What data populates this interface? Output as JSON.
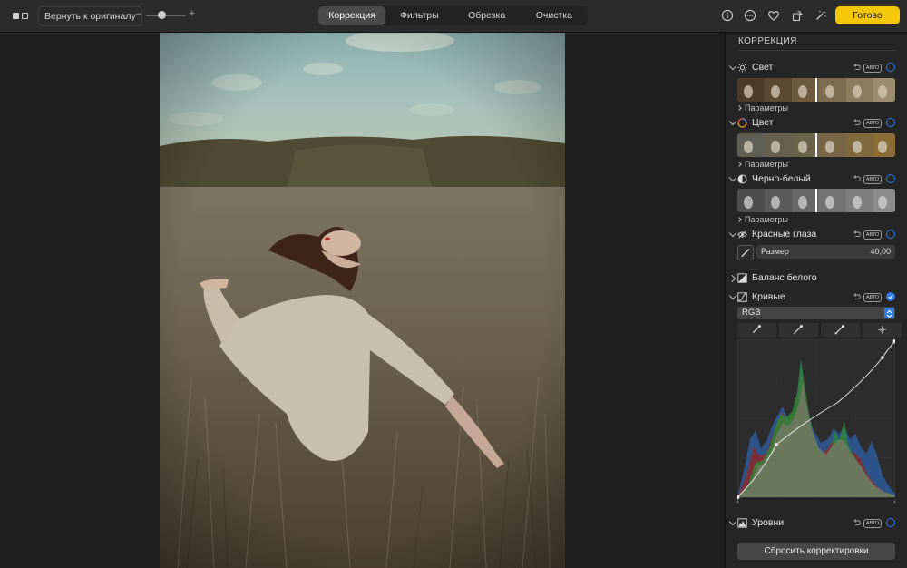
{
  "toolbar": {
    "revert_label": "Вернуть к оригиналу",
    "zoom_minus": "–",
    "zoom_plus": "+",
    "tabs": [
      {
        "label": "Коррекция",
        "active": true
      },
      {
        "label": "Фильтры",
        "active": false
      },
      {
        "label": "Обрезка",
        "active": false
      },
      {
        "label": "Очистка",
        "active": false
      }
    ],
    "done_label": "Готово",
    "accent_color": "#f5c70a",
    "icons": [
      "info-icon",
      "more-icon",
      "heart-icon",
      "rotate-icon",
      "magic-wand-icon"
    ]
  },
  "sidebar": {
    "title": "КОРРЕКЦИЯ",
    "auto_label": "АВТО",
    "params_label": "Параметры",
    "sections": [
      {
        "label": "Свет",
        "expanded": true,
        "enabled": false
      },
      {
        "label": "Цвет",
        "expanded": true,
        "enabled": false
      },
      {
        "label": "Черно-белый",
        "expanded": true,
        "enabled": false
      },
      {
        "label": "Красные глаза",
        "expanded": true,
        "enabled": false
      },
      {
        "label": "Баланс белого",
        "expanded": false
      },
      {
        "label": "Кривые",
        "expanded": true,
        "enabled": true
      },
      {
        "label": "Уровни",
        "expanded": true,
        "enabled": false
      }
    ],
    "red_eye": {
      "size_label": "Размер",
      "size_value": "40,00"
    },
    "curves": {
      "channel": "RGB"
    },
    "reset_label": "Сбросить корректировки",
    "toggle_color": "#2f7be8"
  }
}
